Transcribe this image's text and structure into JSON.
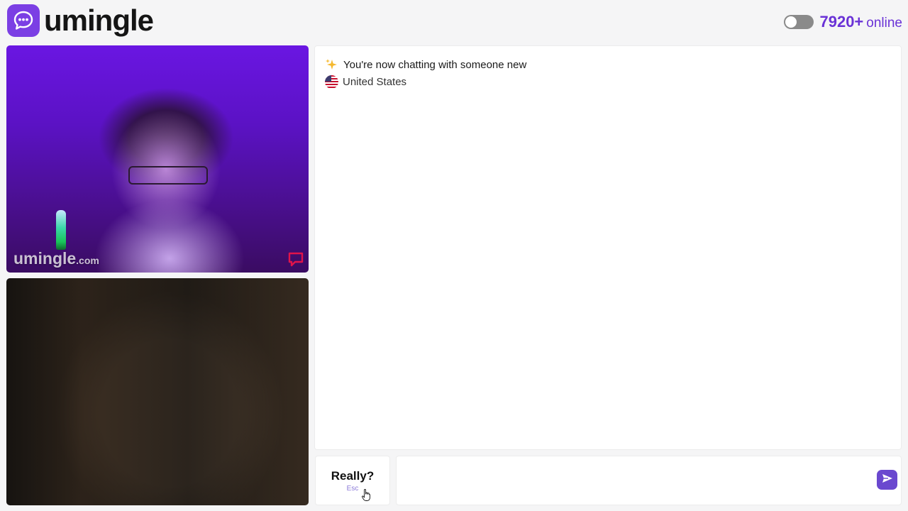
{
  "brand": {
    "name": "umingle",
    "logo_icon": "chat-bubble-icon",
    "accent_color": "#7b3fe4"
  },
  "header": {
    "online_count": "7920+",
    "online_label": "online",
    "toggle_state": "off"
  },
  "remote_video": {
    "watermark": "umingle",
    "watermark_suffix": ".com",
    "report_icon": "report-flag-icon"
  },
  "local_video": {},
  "chat": {
    "system_message": "You're now chatting with someone new",
    "system_icon": "sparkles-icon",
    "country": "United States",
    "country_icon": "us-flag-icon"
  },
  "controls": {
    "skip_label": "Really?",
    "skip_hint": "Esc",
    "message_placeholder": "",
    "send_icon": "send-icon"
  }
}
